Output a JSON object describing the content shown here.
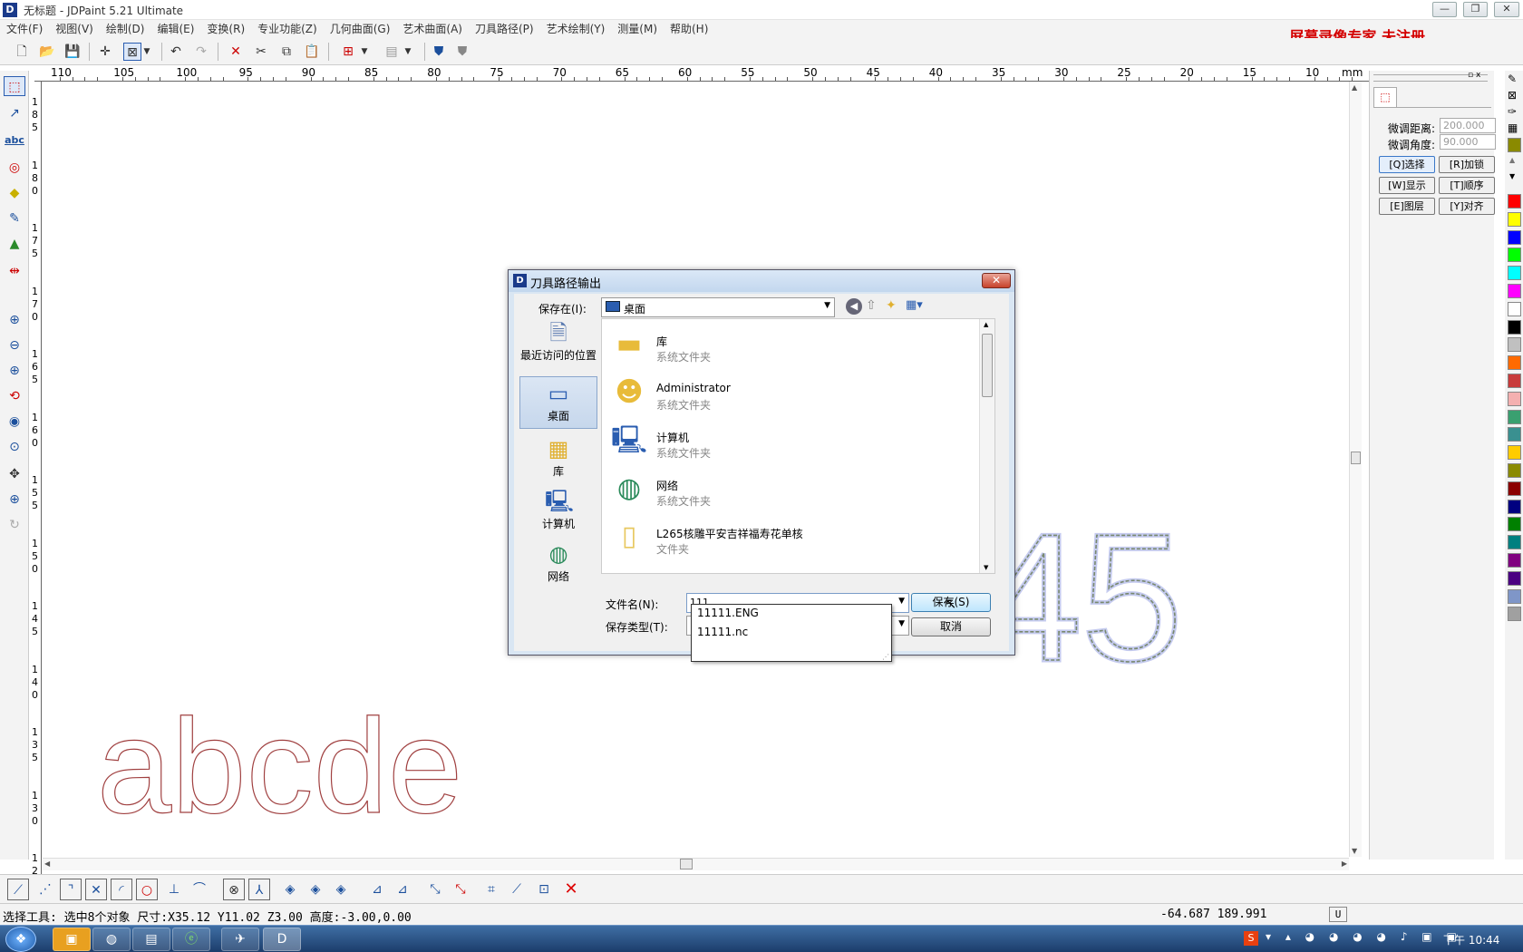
{
  "window": {
    "title": "无标题 - JDPaint 5.21 Ultimate",
    "app_icon": "D",
    "minimize": "—",
    "restore": "❐",
    "close": "✕"
  },
  "menu": [
    "文件(F)",
    "视图(V)",
    "绘制(D)",
    "编辑(E)",
    "变换(R)",
    "专业功能(Z)",
    "几何曲面(G)",
    "艺术曲面(A)",
    "刀具路径(P)",
    "艺术绘制(Y)",
    "测量(M)",
    "帮助(H)"
  ],
  "watermark": "屏幕录像专家 未注册",
  "ruler": {
    "top_labels": [
      "110",
      "105",
      "100",
      "95",
      "90",
      "85",
      "80",
      "75",
      "70",
      "65",
      "60",
      "55",
      "50",
      "45",
      "40",
      "35",
      "30",
      "25",
      "20",
      "15",
      "10"
    ],
    "unit": "mm",
    "left_labels": [
      [
        "1",
        "8",
        "5"
      ],
      [
        "1",
        "8",
        "0"
      ],
      [
        "1",
        "7",
        "5"
      ],
      [
        "1",
        "7",
        "0"
      ],
      [
        "1",
        "6",
        "5"
      ],
      [
        "1",
        "6",
        "0"
      ],
      [
        "1",
        "5",
        "5"
      ],
      [
        "1",
        "5",
        "0"
      ],
      [
        "1",
        "4",
        "5"
      ],
      [
        "1",
        "4",
        "0"
      ],
      [
        "1",
        "3",
        "5"
      ],
      [
        "1",
        "3",
        "0"
      ],
      [
        "1",
        "2"
      ]
    ]
  },
  "canvas": {
    "text_abcde": "abcde",
    "text_45": "45",
    "text_45_color": "#8a9a3a",
    "text_abcde_color": "#a04040"
  },
  "right_panel": {
    "dist_label": "微调距离:",
    "dist_value": "200.000",
    "angle_label": "微调角度:",
    "angle_value": "90.000",
    "buttons": [
      "[Q]选择",
      "[R]加锁",
      "[W]显示",
      "[T]顺序",
      "[E]图层",
      "[Y]对齐"
    ]
  },
  "palette": [
    "#ff0000",
    "#ffff00",
    "#0000ff",
    "#00ff00",
    "#00ffff",
    "#ff00ff",
    "#ffffff",
    "#000000",
    "#c0c0c0",
    "#ff6a00",
    "#c83a3a",
    "#f4b0b0",
    "#3aa070",
    "#3a9090",
    "#ffcc00",
    "#8a8a00",
    "#8b0000",
    "#000080",
    "#008000",
    "#008080",
    "#800080",
    "#4b0082",
    "#7f96c8",
    "#a0a0a0"
  ],
  "status": {
    "text": "选择工具: 选中8个对象 尺寸:X35.12 Y11.02 Z3.00 高度:-3.00,0.00",
    "coords": "-64.687 189.991",
    "mode": "U"
  },
  "taskbar": {
    "clock_period": "下午",
    "clock_time": "10:44",
    "ime": "S"
  },
  "dialog": {
    "title": "刀具路径输出",
    "save_in_label": "保存在(I):",
    "save_in_value": "桌面",
    "places": [
      "最近访问的位置",
      "桌面",
      "库",
      "计算机",
      "网络"
    ],
    "files": [
      {
        "name": "库",
        "type": "系统文件夹"
      },
      {
        "name": "Administrator",
        "type": "系统文件夹"
      },
      {
        "name": "计算机",
        "type": "系统文件夹"
      },
      {
        "name": "网络",
        "type": "系统文件夹"
      },
      {
        "name": "L265核雕平安吉祥福寿花单核",
        "type": "文件夹"
      }
    ],
    "filename_label": "文件名(N):",
    "filename_value": "111",
    "filetype_label": "保存类型(T):",
    "save_button": "保存(S)",
    "cancel_button": "取消",
    "autocomplete": [
      "11111.ENG",
      "11111.nc"
    ]
  }
}
